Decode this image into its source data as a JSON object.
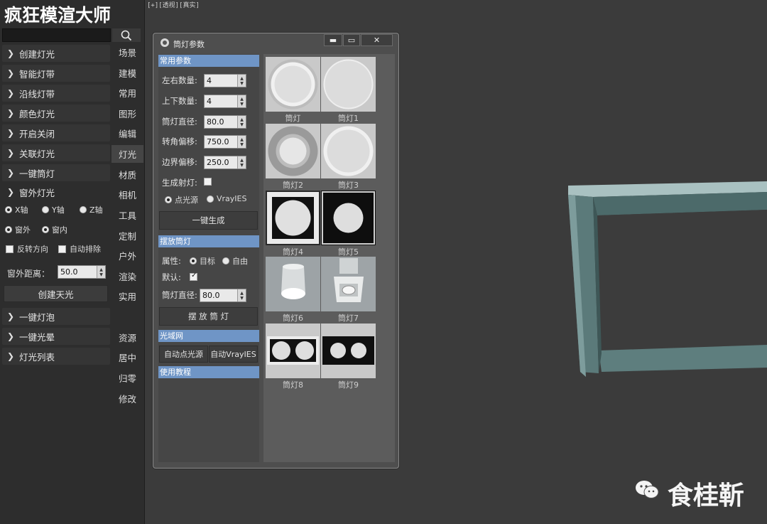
{
  "left_panel": {
    "title": "疯狂模渲大师",
    "accordion": [
      {
        "label": "创建灯光"
      },
      {
        "label": "智能灯带"
      },
      {
        "label": "沿线灯带"
      },
      {
        "label": "颜色灯光"
      },
      {
        "label": "开启关闭"
      },
      {
        "label": "关联灯光"
      },
      {
        "label": "一键筒灯"
      },
      {
        "label": "窗外灯光"
      },
      {
        "label": "一键灯泡"
      },
      {
        "label": "一键光晕"
      },
      {
        "label": "灯光列表"
      }
    ],
    "tabs": [
      "场景",
      "建模",
      "常用",
      "图形",
      "编辑",
      "灯光",
      "材质",
      "相机",
      "工具",
      "定制",
      "户外",
      "渲染",
      "实用",
      "资源",
      "居中",
      "归零",
      "修改"
    ],
    "active_tab": "灯光",
    "window_light": {
      "axis_x": "X轴",
      "axis_y": "Y轴",
      "axis_z": "Z轴",
      "outside": "窗外",
      "inside": "窗内",
      "reverse": "反转方向",
      "auto_exclude": "自动排除",
      "distance_label": "窗外距离：",
      "distance_value": "50.0",
      "create_skylight": "创建天光"
    }
  },
  "viewport": {
    "label": "[+][透视][真实]"
  },
  "dialog": {
    "title": "筒灯参数",
    "common_header": "常用参数",
    "fields": [
      {
        "label": "左右数量:",
        "value": "4"
      },
      {
        "label": "上下数量:",
        "value": "4"
      },
      {
        "label": "筒灯直径:",
        "value": "80.0"
      },
      {
        "label": "转角偏移:",
        "value": "750.0"
      },
      {
        "label": "边界偏移:",
        "value": "250.0"
      }
    ],
    "gen_light": "生成射灯:",
    "point_source": "点光源",
    "vray_ies": "VrayIES",
    "generate": "一键生成",
    "place_header": "摆放筒灯",
    "property_label": "属性:",
    "target": "目标",
    "free": "自由",
    "default_label": "默认:",
    "place_diameter_label": "筒灯直径:",
    "place_diameter_value": "80.0",
    "place_button": "摆 放 筒 灯",
    "ies_header": "光域网",
    "auto_point": "自动点光源",
    "auto_vray": "自动VrayIES",
    "tutorial_header": "使用教程",
    "thumbs": [
      "筒灯",
      "筒灯1",
      "筒灯2",
      "筒灯3",
      "筒灯4",
      "筒灯5",
      "筒灯6",
      "筒灯7",
      "筒灯8",
      "筒灯9"
    ]
  },
  "watermark": "食桂靳"
}
